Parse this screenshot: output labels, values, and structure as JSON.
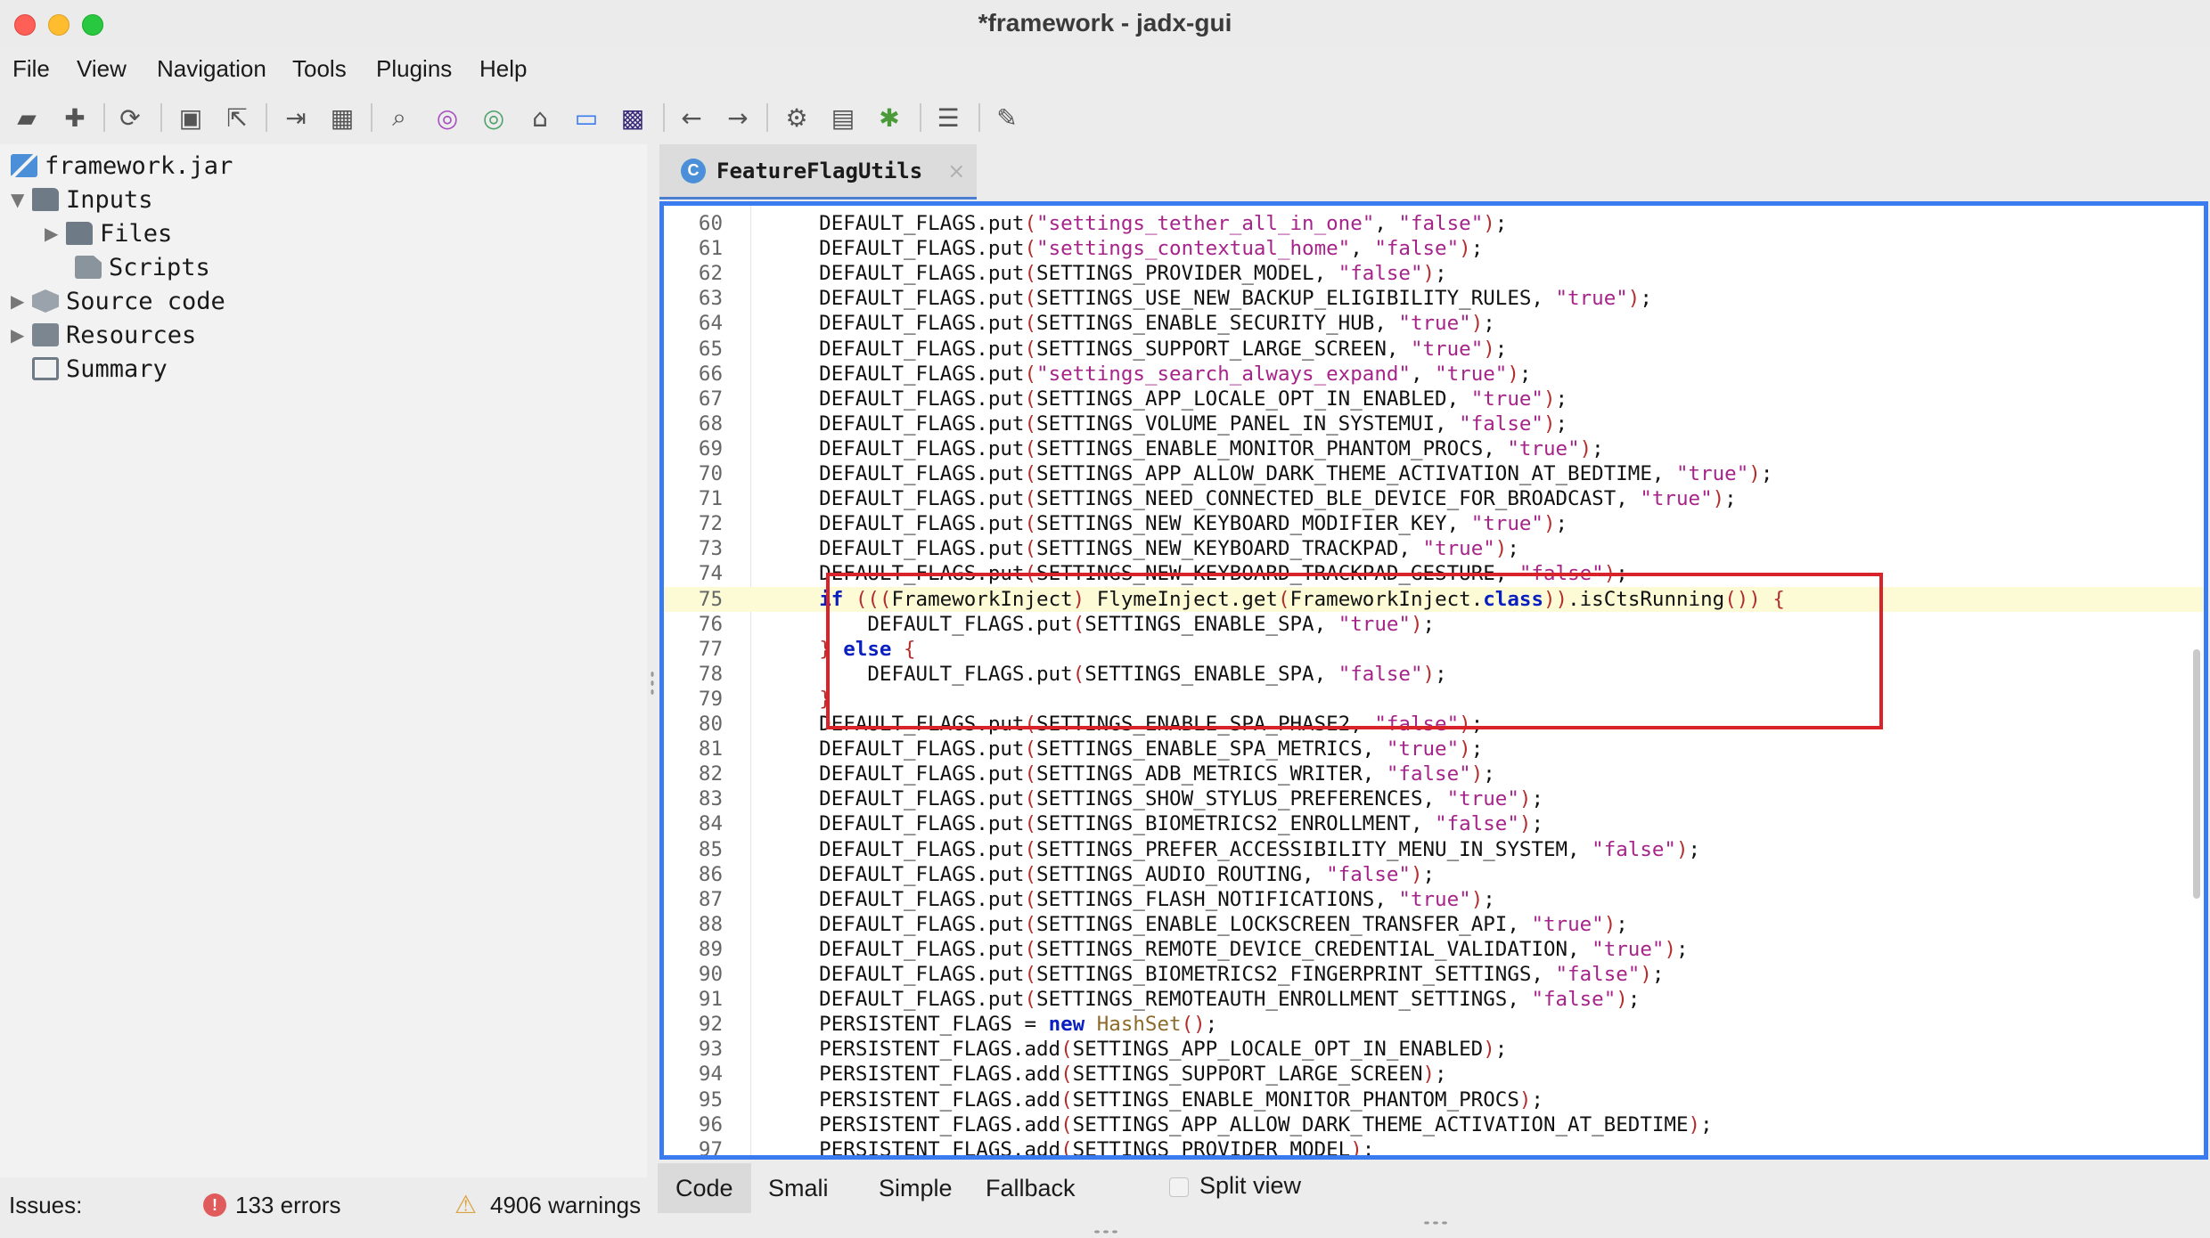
{
  "window": {
    "title": "*framework - jadx-gui"
  },
  "menu": [
    "File",
    "View",
    "Navigation",
    "Tools",
    "Plugins",
    "Help"
  ],
  "toolbar_icons": [
    "open-file-icon",
    "add-files-icon",
    "reload-icon",
    "save-all-icon",
    "export-icon",
    "sync-with-editor-icon",
    "flatten-packages-icon",
    "search-icon",
    "find-usage-icon",
    "find-class-icon",
    "home-icon",
    "quark-icon",
    "smali-icon",
    "back-icon",
    "forward-icon",
    "deobfuscation-icon",
    "decompile-all-icon",
    "debugger-icon",
    "log-viewer-icon",
    "preferences-icon"
  ],
  "tree": {
    "root": "framework.jar",
    "inputs": "Inputs",
    "files": "Files",
    "scripts": "Scripts",
    "source_code": "Source code",
    "resources": "Resources",
    "summary": "Summary"
  },
  "tab": {
    "icon_letter": "C",
    "label": "FeatureFlagUtils",
    "close": "×"
  },
  "code_lines": [
    {
      "n": "60",
      "t": "DEFAULT_FLAGS.put(\"settings_tether_all_in_one\", \"false\");"
    },
    {
      "n": "61",
      "t": "DEFAULT_FLAGS.put(\"settings_contextual_home\", \"false\");"
    },
    {
      "n": "62",
      "t": "DEFAULT_FLAGS.put(SETTINGS_PROVIDER_MODEL, \"false\");"
    },
    {
      "n": "63",
      "t": "DEFAULT_FLAGS.put(SETTINGS_USE_NEW_BACKUP_ELIGIBILITY_RULES, \"true\");"
    },
    {
      "n": "64",
      "t": "DEFAULT_FLAGS.put(SETTINGS_ENABLE_SECURITY_HUB, \"true\");"
    },
    {
      "n": "65",
      "t": "DEFAULT_FLAGS.put(SETTINGS_SUPPORT_LARGE_SCREEN, \"true\");"
    },
    {
      "n": "66",
      "t": "DEFAULT_FLAGS.put(\"settings_search_always_expand\", \"true\");"
    },
    {
      "n": "67",
      "t": "DEFAULT_FLAGS.put(SETTINGS_APP_LOCALE_OPT_IN_ENABLED, \"true\");"
    },
    {
      "n": "68",
      "t": "DEFAULT_FLAGS.put(SETTINGS_VOLUME_PANEL_IN_SYSTEMUI, \"false\");"
    },
    {
      "n": "69",
      "t": "DEFAULT_FLAGS.put(SETTINGS_ENABLE_MONITOR_PHANTOM_PROCS, \"true\");"
    },
    {
      "n": "70",
      "t": "DEFAULT_FLAGS.put(SETTINGS_APP_ALLOW_DARK_THEME_ACTIVATION_AT_BEDTIME, \"true\");"
    },
    {
      "n": "71",
      "t": "DEFAULT_FLAGS.put(SETTINGS_NEED_CONNECTED_BLE_DEVICE_FOR_BROADCAST, \"true\");"
    },
    {
      "n": "72",
      "t": "DEFAULT_FLAGS.put(SETTINGS_NEW_KEYBOARD_MODIFIER_KEY, \"true\");"
    },
    {
      "n": "73",
      "t": "DEFAULT_FLAGS.put(SETTINGS_NEW_KEYBOARD_TRACKPAD, \"true\");"
    },
    {
      "n": "74",
      "t": "DEFAULT_FLAGS.put(SETTINGS_NEW_KEYBOARD_TRACKPAD_GESTURE, \"false\");"
    },
    {
      "n": "75",
      "t": "if (((FrameworkInject) FlymeInject.get(FrameworkInject.class)).isCtsRunning()) {"
    },
    {
      "n": "76",
      "t": "    DEFAULT_FLAGS.put(SETTINGS_ENABLE_SPA, \"true\");"
    },
    {
      "n": "77",
      "t": "} else {"
    },
    {
      "n": "78",
      "t": "    DEFAULT_FLAGS.put(SETTINGS_ENABLE_SPA, \"false\");"
    },
    {
      "n": "79",
      "t": "}"
    },
    {
      "n": "80",
      "t": "DEFAULT_FLAGS.put(SETTINGS_ENABLE_SPA_PHASE2, \"false\");"
    },
    {
      "n": "81",
      "t": "DEFAULT_FLAGS.put(SETTINGS_ENABLE_SPA_METRICS, \"true\");"
    },
    {
      "n": "82",
      "t": "DEFAULT_FLAGS.put(SETTINGS_ADB_METRICS_WRITER, \"false\");"
    },
    {
      "n": "83",
      "t": "DEFAULT_FLAGS.put(SETTINGS_SHOW_STYLUS_PREFERENCES, \"true\");"
    },
    {
      "n": "84",
      "t": "DEFAULT_FLAGS.put(SETTINGS_BIOMETRICS2_ENROLLMENT, \"false\");"
    },
    {
      "n": "85",
      "t": "DEFAULT_FLAGS.put(SETTINGS_PREFER_ACCESSIBILITY_MENU_IN_SYSTEM, \"false\");"
    },
    {
      "n": "86",
      "t": "DEFAULT_FLAGS.put(SETTINGS_AUDIO_ROUTING, \"false\");"
    },
    {
      "n": "87",
      "t": "DEFAULT_FLAGS.put(SETTINGS_FLASH_NOTIFICATIONS, \"true\");"
    },
    {
      "n": "88",
      "t": "DEFAULT_FLAGS.put(SETTINGS_ENABLE_LOCKSCREEN_TRANSFER_API, \"true\");"
    },
    {
      "n": "89",
      "t": "DEFAULT_FLAGS.put(SETTINGS_REMOTE_DEVICE_CREDENTIAL_VALIDATION, \"true\");"
    },
    {
      "n": "90",
      "t": "DEFAULT_FLAGS.put(SETTINGS_BIOMETRICS2_FINGERPRINT_SETTINGS, \"false\");"
    },
    {
      "n": "91",
      "t": "DEFAULT_FLAGS.put(SETTINGS_REMOTEAUTH_ENROLLMENT_SETTINGS, \"false\");"
    },
    {
      "n": "92",
      "t": "PERSISTENT_FLAGS = new HashSet();"
    },
    {
      "n": "93",
      "t": "PERSISTENT_FLAGS.add(SETTINGS_APP_LOCALE_OPT_IN_ENABLED);"
    },
    {
      "n": "94",
      "t": "PERSISTENT_FLAGS.add(SETTINGS_SUPPORT_LARGE_SCREEN);"
    },
    {
      "n": "95",
      "t": "PERSISTENT_FLAGS.add(SETTINGS_ENABLE_MONITOR_PHANTOM_PROCS);"
    },
    {
      "n": "96",
      "t": "PERSISTENT_FLAGS.add(SETTINGS_APP_ALLOW_DARK_THEME_ACTIVATION_AT_BEDTIME);"
    },
    {
      "n": "97",
      "t": "PERSISTENT_FLAGS.add(SETTINGS_PROVIDER_MODEL);"
    }
  ],
  "highlighted_line": "75",
  "view_tabs": [
    "Code",
    "Smali",
    "Simple",
    "Fallback"
  ],
  "split_view": {
    "label": "Split view",
    "checked": false
  },
  "status": {
    "issues_label": "Issues:",
    "errors": "133 errors",
    "warnings": "4906 warnings"
  },
  "colors": {
    "editor_border": "#3a7bf0",
    "annotation_box": "#d9232a",
    "string_literal": "#a6238a",
    "keyword": "#0a1fbf",
    "line_highlight": "#fcfbd6"
  }
}
